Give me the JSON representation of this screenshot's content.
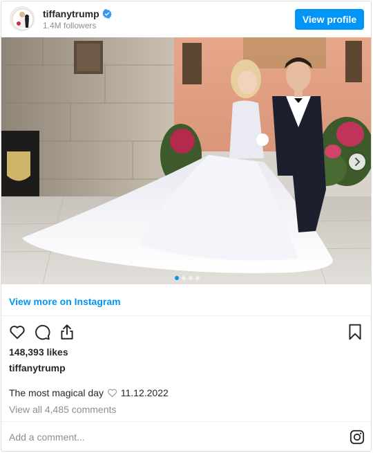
{
  "header": {
    "username": "tiffanytrump",
    "followers": "1.4M followers",
    "view_profile_label": "View profile",
    "verified_icon": "verified-badge-icon"
  },
  "photo": {
    "alt_subject": "bride-and-groom-photo",
    "carousel_dots": 4,
    "active_dot": 1,
    "next_icon": "chevron-right-icon"
  },
  "links": {
    "view_more": "View more on Instagram"
  },
  "actions": {
    "like_icon": "heart-icon",
    "comment_icon": "comment-bubble-icon",
    "share_icon": "share-icon",
    "save_icon": "bookmark-icon"
  },
  "post": {
    "likes": "148,393 likes",
    "owner": "tiffanytrump",
    "caption_before": "The most magical day",
    "caption_after": "11.12.2022",
    "view_comments": "View all 4,485 comments"
  },
  "comment_bar": {
    "placeholder": "Add a comment...",
    "logo_icon": "instagram-logo-icon"
  },
  "colors": {
    "accent": "#0095f6",
    "text": "#262626",
    "muted": "#8e8e8e",
    "border": "#dbdbdb"
  }
}
